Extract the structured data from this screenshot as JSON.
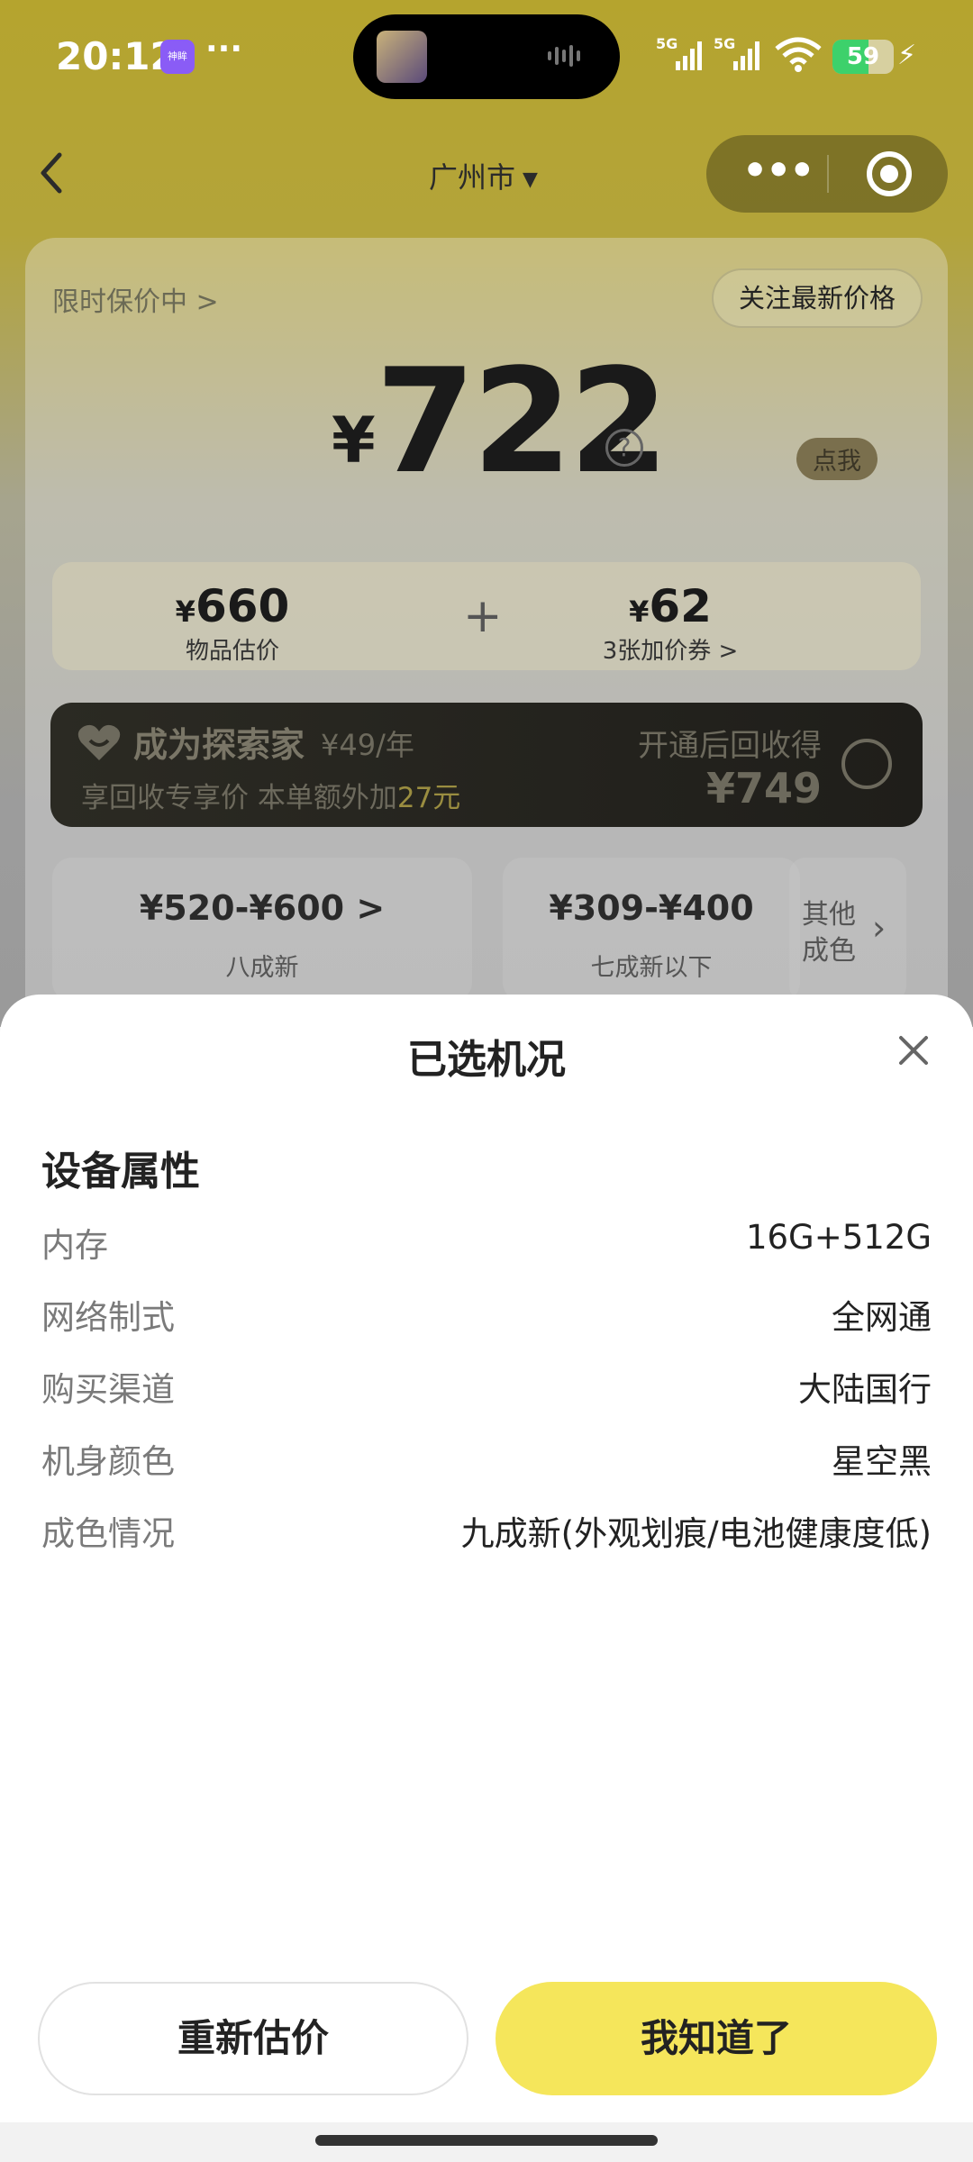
{
  "status_bar": {
    "time": "20:12",
    "app_badge": "神眸",
    "more": "···",
    "network_1": "5G",
    "network_2": "5G",
    "battery": "59",
    "battery_level": 0.59,
    "colors": {
      "battery_fill": "#3dd16b"
    }
  },
  "nav": {
    "city": "广州市",
    "caret": "▼",
    "more_dots": "•••"
  },
  "price_card": {
    "hint": "限时保价中 >",
    "follow_button": "关注最新价格",
    "currency": "¥",
    "price": "722",
    "help": "?",
    "breakdown": {
      "left_value": "660",
      "left_label": "物品估价",
      "plus": "+",
      "right_value": "62",
      "right_label": "3张加价券 >"
    },
    "member": {
      "click_tag": "点我",
      "title": "成为探索家",
      "fee": "¥49/年",
      "sub_prefix": "享回收专享价 本单额外加",
      "sub_highlight": "27元",
      "right_title": "开通后回收得",
      "right_value": "¥749"
    },
    "grades": [
      {
        "price": "¥520-¥600 >",
        "label": "八成新"
      },
      {
        "price": "¥309-¥400",
        "label": "七成新以下"
      }
    ],
    "other_grade": "其他成色",
    "other_arrow": "›"
  },
  "sheet": {
    "title": "已选机况",
    "section_title": "设备属性",
    "attributes": [
      {
        "key": "内存",
        "value": "16G+512G"
      },
      {
        "key": "网络制式",
        "value": "全网通"
      },
      {
        "key": "购买渠道",
        "value": "大陆国行"
      },
      {
        "key": "机身颜色",
        "value": "星空黑"
      },
      {
        "key": "成色情况",
        "value": "九成新(外观划痕/电池健康度低)"
      }
    ],
    "reassess_button": "重新估价",
    "ok_button": "我知道了",
    "colors": {
      "ok_button": "#f5e65b"
    }
  }
}
